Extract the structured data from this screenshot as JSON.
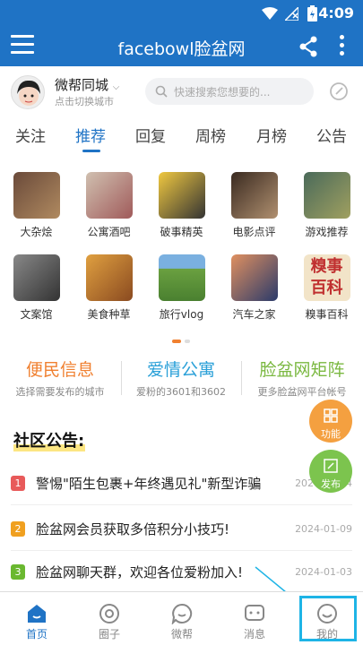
{
  "status": {
    "time": "4:09"
  },
  "appbar": {
    "title": "facebowl脸盆网"
  },
  "city": {
    "name": "微帮同城",
    "sub": "点击切换城市"
  },
  "search": {
    "placeholder": "快速搜索您想要的..."
  },
  "tabs": [
    "关注",
    "推荐",
    "回复",
    "周榜",
    "月榜",
    "公告"
  ],
  "categories": [
    {
      "label": "大杂烩",
      "color": "#6a4a3a"
    },
    {
      "label": "公寓酒吧",
      "color": "#a05a5a"
    },
    {
      "label": "破事精英",
      "color": "#e0b030"
    },
    {
      "label": "电影点评",
      "color": "#7a5a3a"
    },
    {
      "label": "游戏推荐",
      "color": "#5a7a6a"
    },
    {
      "label": "文案馆",
      "color": "#555"
    },
    {
      "label": "美食种草",
      "color": "#c07030"
    },
    {
      "label": "旅行vlog",
      "color": "#6aa040"
    },
    {
      "label": "汽车之家",
      "color": "#4a6090"
    },
    {
      "label": "糗事百科",
      "color": "#c8962e"
    }
  ],
  "features": [
    {
      "title": "便民信息",
      "sub": "选择需要发布的城市",
      "color": "#f08030"
    },
    {
      "title": "爱情公寓",
      "sub": "爱粉的3601和3602",
      "color": "#2aa0d8"
    },
    {
      "title": "脸盆网矩阵",
      "sub": "更多脸盆网平台帐号",
      "color": "#7ab840"
    }
  ],
  "announcement": {
    "heading": "社区公告:"
  },
  "news": [
    {
      "num": "1",
      "text": "警惕\"陌生包裹+年终遇见礼\"新型诈骗",
      "date": "2024-01-04",
      "color": "#e85a5a"
    },
    {
      "num": "2",
      "text": "脸盆网会员获取多倍积分小技巧!",
      "date": "2024-01-09",
      "color": "#f0a020"
    },
    {
      "num": "3",
      "text": "脸盆网聊天群，欢迎各位爱粉加入!",
      "date": "2024-01-03",
      "color": "#6ab830"
    }
  ],
  "fabs": [
    {
      "label": "功能",
      "color": "#f4a040"
    },
    {
      "label": "发布",
      "color": "#7cc44e"
    }
  ],
  "bottom": [
    "首页",
    "圈子",
    "微帮",
    "消息",
    "我的"
  ]
}
